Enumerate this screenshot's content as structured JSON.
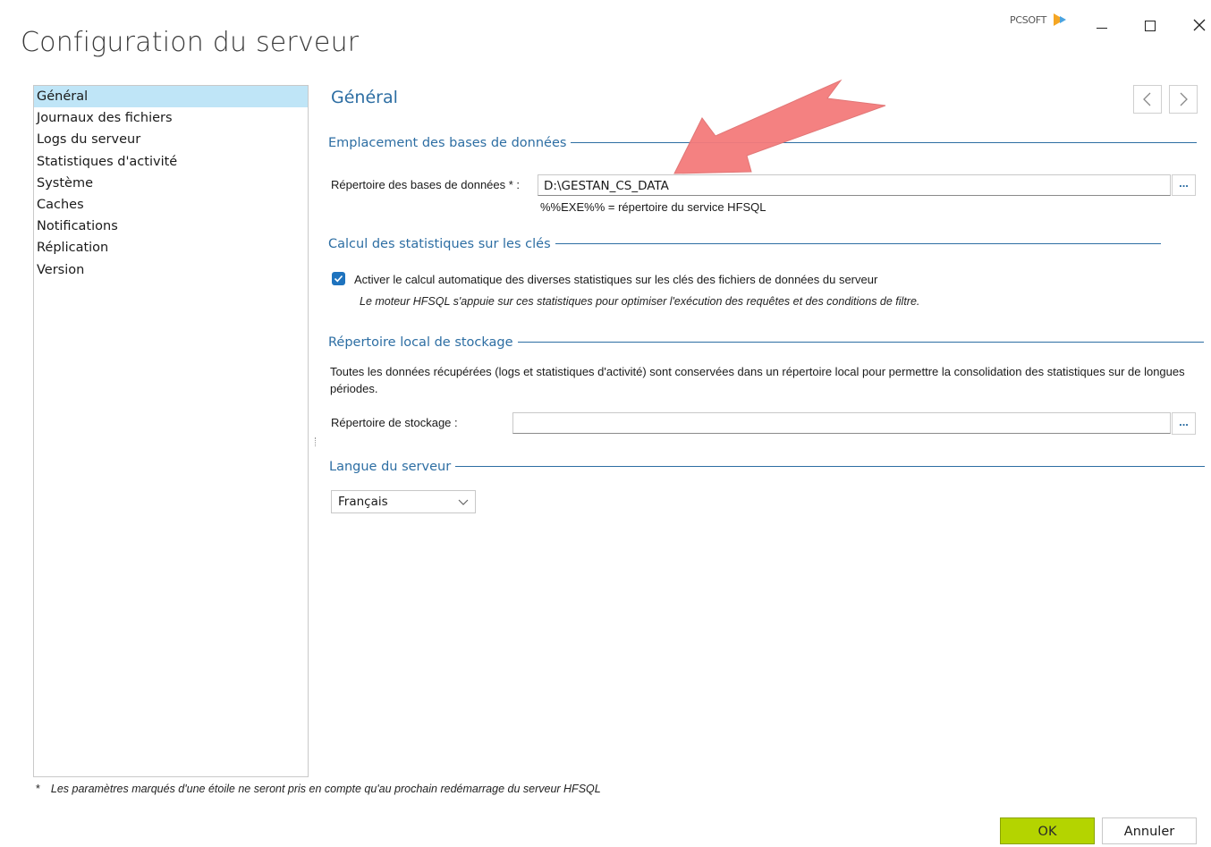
{
  "window": {
    "title": "Configuration du serveur",
    "brand": "PCSOFT"
  },
  "sidebar": {
    "items": [
      {
        "label": "Général",
        "selected": true
      },
      {
        "label": "Journaux des fichiers"
      },
      {
        "label": "Logs du serveur"
      },
      {
        "label": "Statistiques d'activité"
      },
      {
        "label": "Système"
      },
      {
        "label": "Caches"
      },
      {
        "label": "Notifications"
      },
      {
        "label": "Réplication"
      },
      {
        "label": "Version"
      }
    ]
  },
  "main": {
    "title": "Général",
    "databases": {
      "group_title": "Emplacement des bases de données",
      "dir_label": "Répertoire des bases de données * :",
      "dir_value": "D:\\GESTAN_CS_DATA",
      "browse_label": "...",
      "hint": "%%EXE%% = répertoire du service HFSQL"
    },
    "stats": {
      "group_title": "Calcul des statistiques sur les clés",
      "checkbox_label": "Activer le calcul automatique des diverses statistiques sur les clés des fichiers de données du serveur",
      "checked": true,
      "note": "Le moteur HFSQL s'appuie sur ces statistiques pour optimiser l'exécution des requêtes et des conditions de filtre."
    },
    "storage": {
      "group_title": "Répertoire local de stockage",
      "description": "Toutes les données récupérées (logs et statistiques d'activité) sont conservées dans un répertoire local pour permettre la consolidation des statistiques sur de longues périodes.",
      "dir_label": "Répertoire de stockage :",
      "dir_value": "",
      "browse_label": "..."
    },
    "language": {
      "group_title": "Langue du serveur",
      "selected": "Français"
    }
  },
  "footer": {
    "note_star": "*",
    "note": "Les paramètres marqués d'une étoile ne seront pris en compte qu'au prochain redémarrage du serveur HFSQL",
    "ok_label": "OK",
    "cancel_label": "Annuler"
  },
  "colors": {
    "accent": "#2d6ea3",
    "selected_bg": "#bfe5f7",
    "ok_button": "#b4d400",
    "annotation_arrow": "#f47b7b"
  }
}
